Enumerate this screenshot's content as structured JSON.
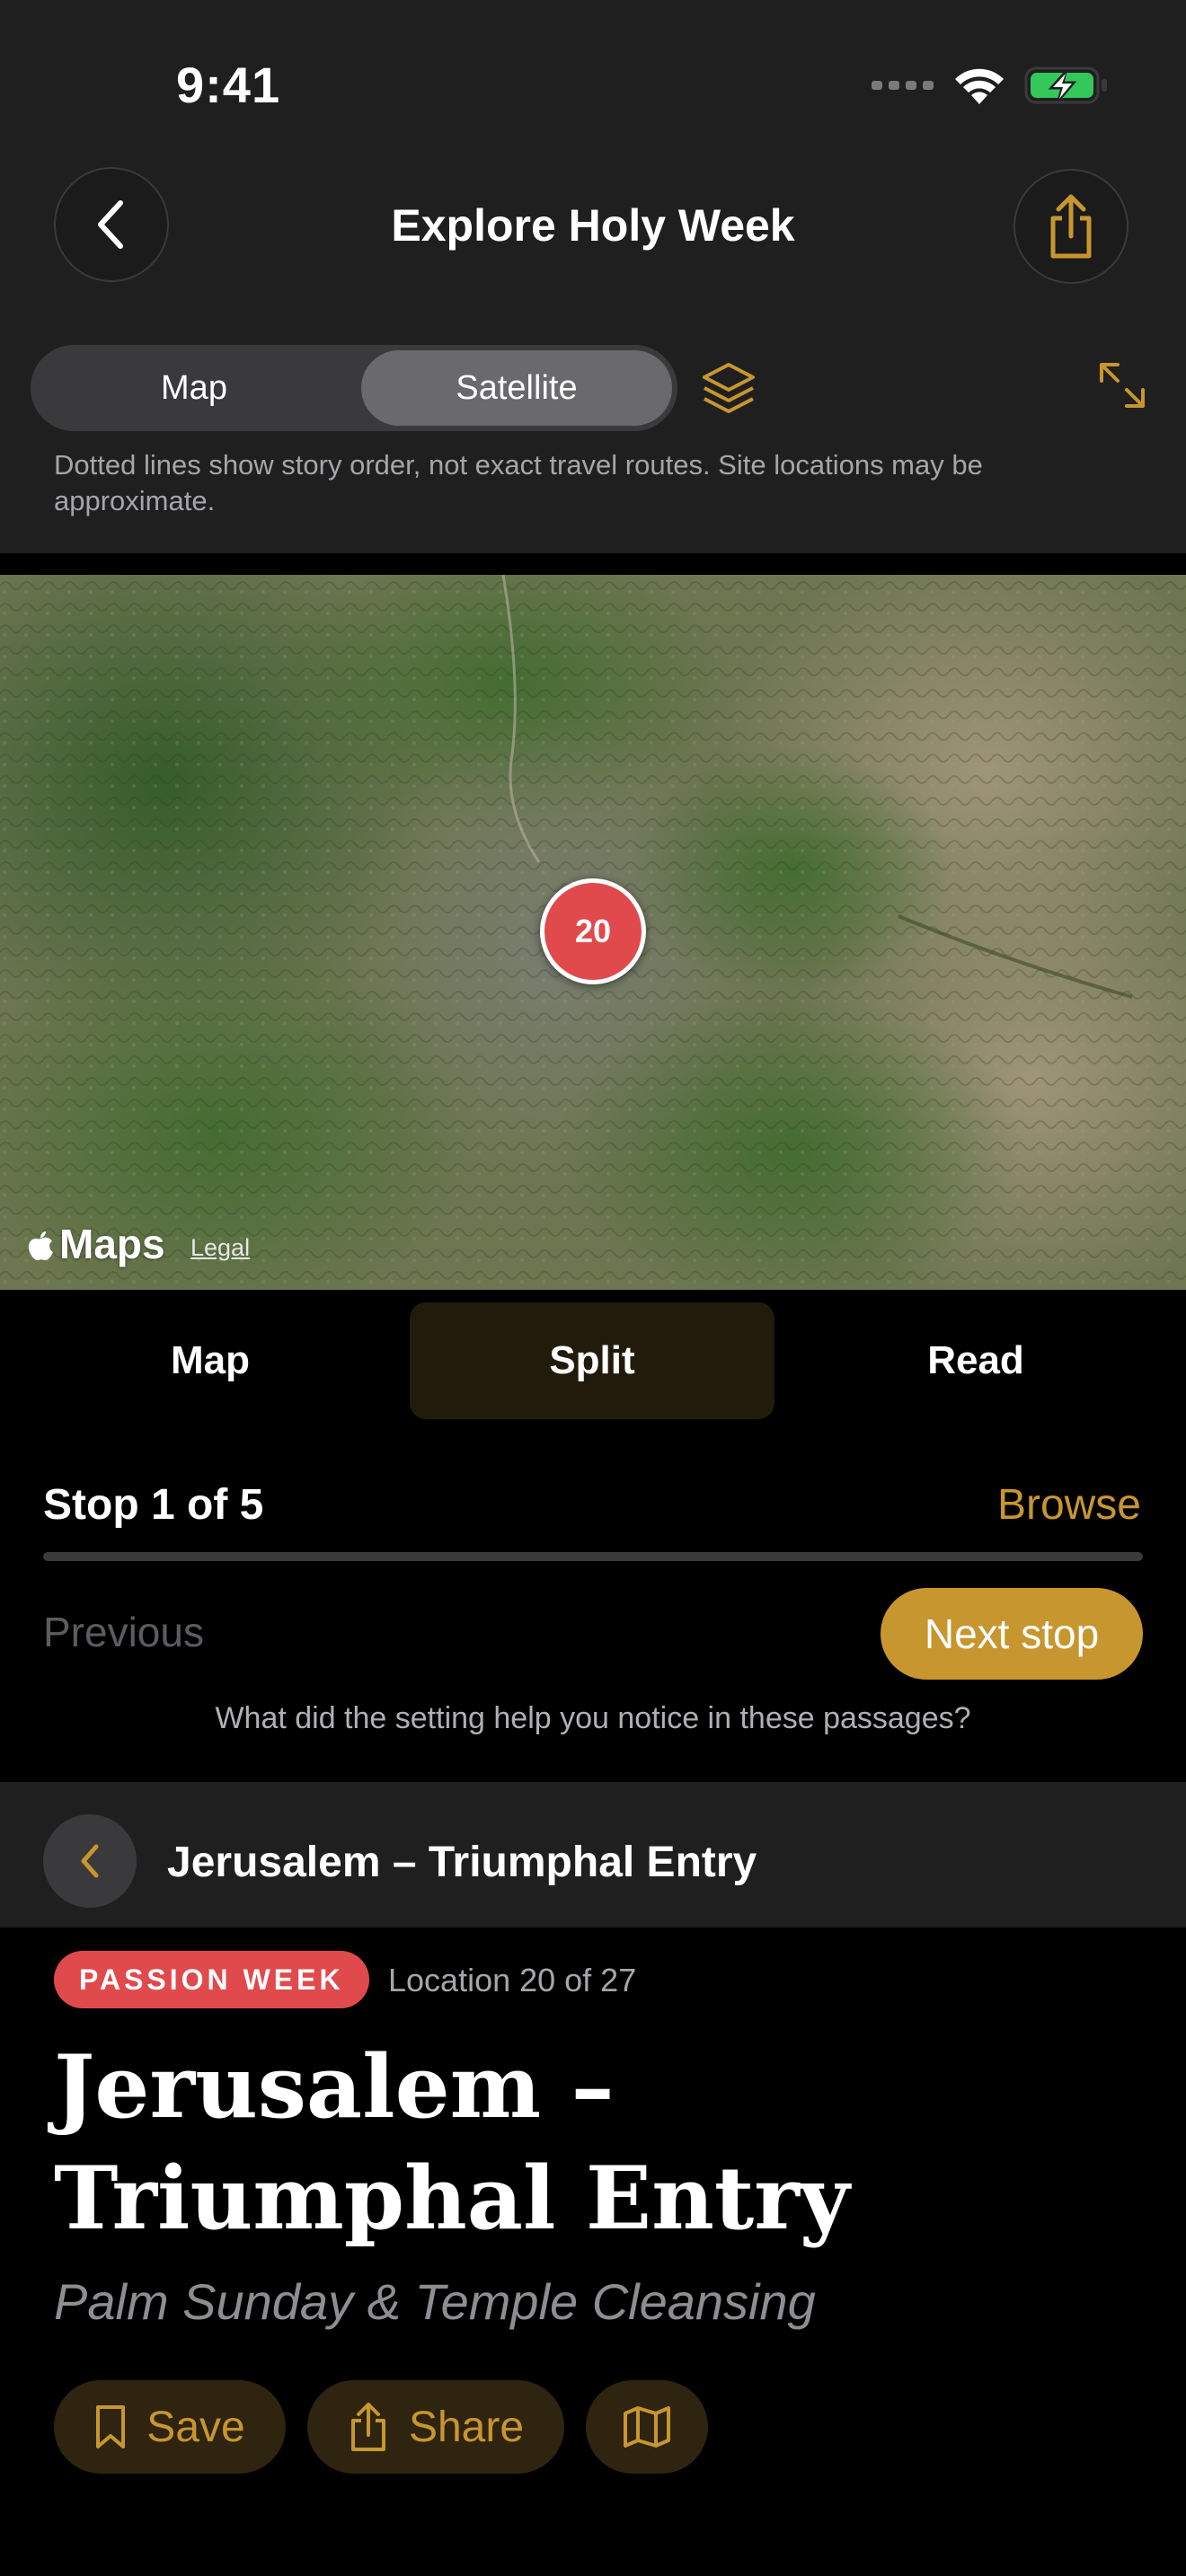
{
  "status_bar": {
    "time": "9:41"
  },
  "nav": {
    "title": "Explore Holy Week",
    "back_icon": "chevron-left-icon",
    "share_icon": "share-icon"
  },
  "map_type": {
    "options": [
      "Map",
      "Satellite"
    ],
    "selected": "Satellite"
  },
  "disclaimer": "Dotted lines show story order, not exact travel routes. Site locations may be approximate.",
  "map": {
    "pin_label": "20",
    "pin_color": "#e04a4d",
    "attribution": "Maps",
    "legal": "Legal"
  },
  "view_modes": {
    "map": "Map",
    "split": "Split",
    "read": "Read",
    "selected": "Split"
  },
  "stop": {
    "label": "Stop 1 of 5",
    "browse": "Browse",
    "previous": "Previous",
    "next": "Next stop",
    "question": "What did the setting help you notice in these passages?"
  },
  "location": {
    "bar_title": "Jerusalem – Triumphal Entry",
    "badge": "PASSION WEEK",
    "count": "Location 20 of 27",
    "title": "Jerusalem – Triumphal Entry",
    "subtitle": "Palm Sunday & Temple Cleansing",
    "actions": {
      "save": "Save",
      "share": "Share"
    }
  },
  "colors": {
    "accent": "#c8962f",
    "badge": "#e04a4d",
    "background": "#000000",
    "header": "#1f1f20"
  }
}
